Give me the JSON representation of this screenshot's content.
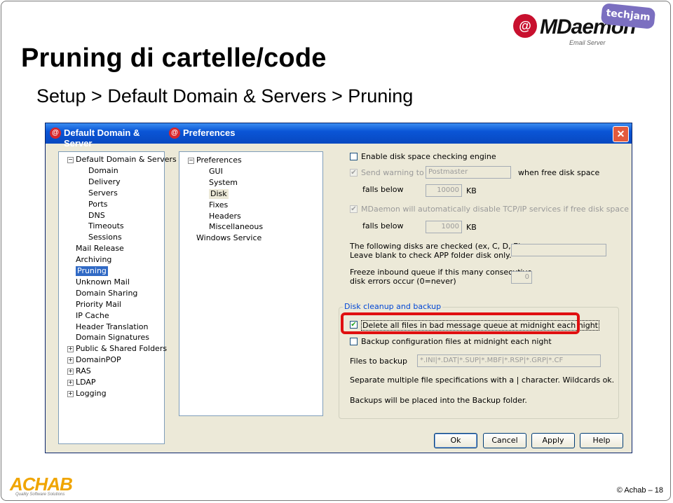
{
  "slide": {
    "title": "Pruning di cartelle/code",
    "subtitle": "Setup > Default Domain & Servers > Pruning",
    "brand": "MDaemon",
    "brand_sub": "Email Server",
    "badge": "techjam",
    "footer_logo": "ACHAB",
    "footer_logo_sub": "Quality Software Solutions",
    "footer": "© Achab – 18"
  },
  "window": {
    "back_title": "Default Domain & Server",
    "front_title": "Preferences",
    "close_glyph": "✕"
  },
  "tree_left": [
    {
      "label": "Default Domain & Servers",
      "level": 0,
      "pm": "-"
    },
    {
      "label": "Domain",
      "level": 1
    },
    {
      "label": "Delivery",
      "level": 1
    },
    {
      "label": "Servers",
      "level": 1
    },
    {
      "label": "Ports",
      "level": 1
    },
    {
      "label": "DNS",
      "level": 1
    },
    {
      "label": "Timeouts",
      "level": 1
    },
    {
      "label": "Sessions",
      "level": 1
    },
    {
      "label": "Mail Release",
      "level": 0
    },
    {
      "label": "Archiving",
      "level": 0
    },
    {
      "label": "Pruning",
      "level": 0,
      "selected": true
    },
    {
      "label": "Unknown Mail",
      "level": 0
    },
    {
      "label": "Domain Sharing",
      "level": 0
    },
    {
      "label": "Priority Mail",
      "level": 0
    },
    {
      "label": "IP Cache",
      "level": 0
    },
    {
      "label": "Header Translation",
      "level": 0
    },
    {
      "label": "Domain Signatures",
      "level": 0
    },
    {
      "label": "Public & Shared Folders",
      "level": 0,
      "pm": "+"
    },
    {
      "label": "DomainPOP",
      "level": 0,
      "pm": "+"
    },
    {
      "label": "RAS",
      "level": 0,
      "pm": "+"
    },
    {
      "label": "LDAP",
      "level": 0,
      "pm": "+"
    },
    {
      "label": "Logging",
      "level": 0,
      "pm": "+"
    }
  ],
  "tree_right": [
    {
      "label": "Preferences",
      "level": 0,
      "pm": "-"
    },
    {
      "label": "GUI",
      "level": 1
    },
    {
      "label": "System",
      "level": 1
    },
    {
      "label": "Disk",
      "level": 1,
      "current": true
    },
    {
      "label": "Fixes",
      "level": 1
    },
    {
      "label": "Headers",
      "level": 1
    },
    {
      "label": "Miscellaneous",
      "level": 1
    },
    {
      "label": "Windows Service",
      "level": 0
    }
  ],
  "disk": {
    "enable_label": "Enable disk space checking engine",
    "send_warning_label": "Send warning to",
    "send_warning_value": "Postmaster",
    "when_free": "when free disk space",
    "falls_below_1": "falls below",
    "value_1": "10000",
    "kb_1": "KB",
    "auto_disable_label": "MDaemon will automatically disable TCP/IP services if free disk space",
    "falls_below_2": "falls below",
    "value_2": "1000",
    "kb_2": "KB",
    "disks_line1": "The following disks are checked (ex, C, D, E)",
    "disks_line2": "Leave blank to check APP folder disk only.",
    "disks_value": "",
    "freeze_line1": "Freeze inbound queue if this many consecutive",
    "freeze_line2": "disk errors occur (0=never)",
    "freeze_value": "0"
  },
  "cleanup": {
    "group_label": "Disk cleanup and backup",
    "delete_label": "Delete all files in bad message queue at midnight each night",
    "delete_checked": true,
    "backup_label": "Backup configuration files at midnight each night",
    "backup_checked": false,
    "files_label": "Files to backup",
    "files_value": "*.INI|*.DAT|*.SUP|*.MBF|*.RSP|*.GRP|*.CF",
    "separate_note": "Separate multiple file specifications with a | character.  Wildcards ok.",
    "backup_note": "Backups will be placed into the Backup folder."
  },
  "buttons": {
    "ok": "Ok",
    "cancel": "Cancel",
    "apply": "Apply",
    "help": "Help"
  }
}
